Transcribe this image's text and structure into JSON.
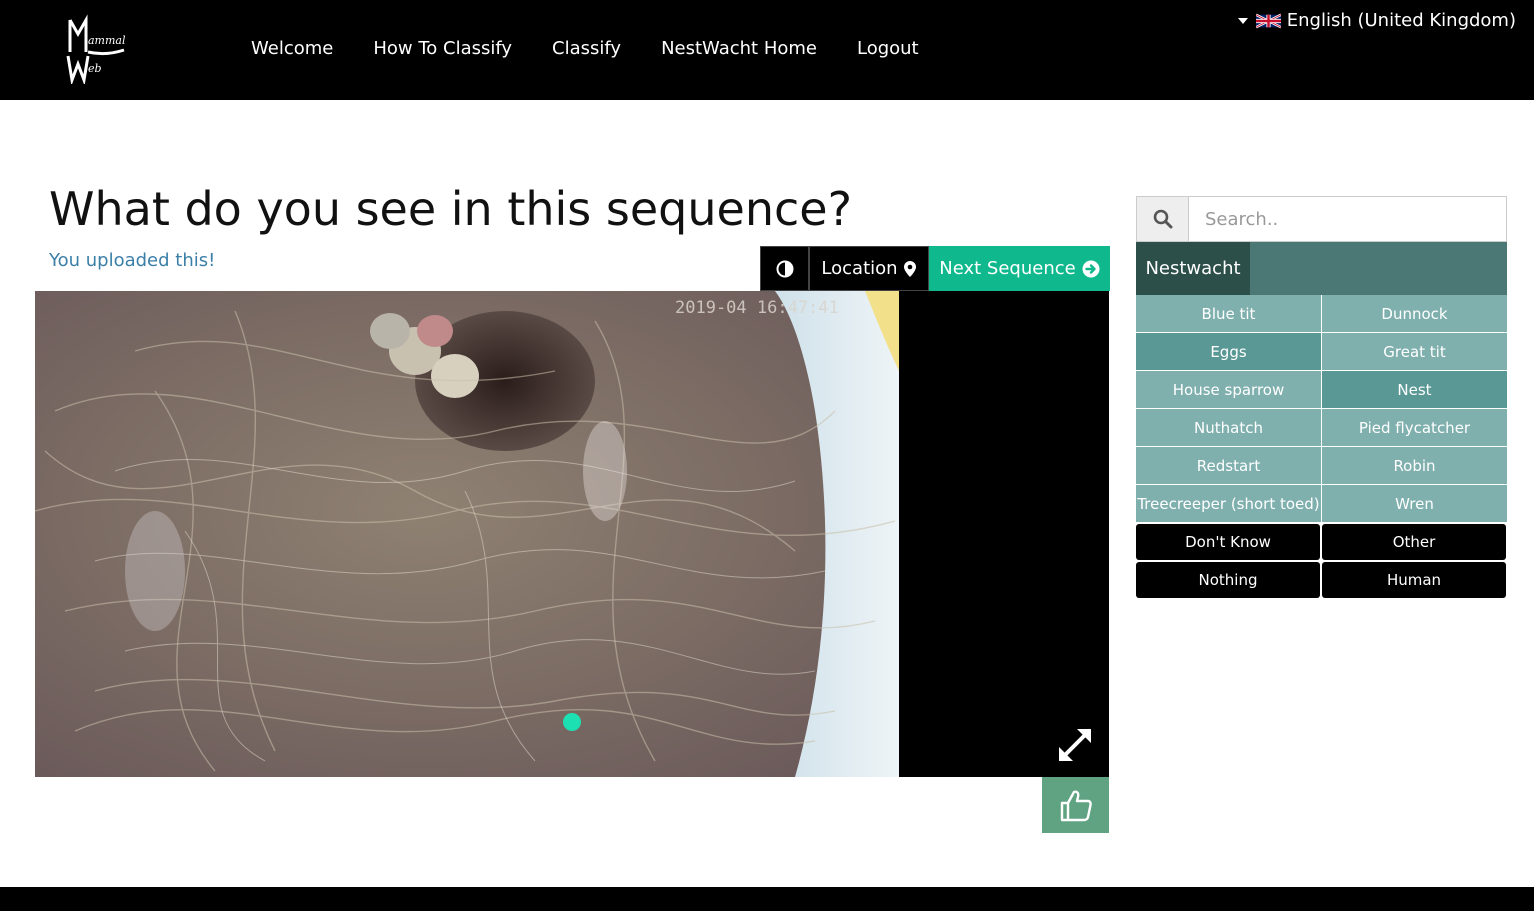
{
  "header": {
    "logo_alt": "Mammal Web",
    "nav": [
      "Welcome",
      "How To Classify",
      "Classify",
      "NestWacht Home",
      "Logout"
    ],
    "language": "English (United Kingdom)"
  },
  "main": {
    "title": "What do you see in this sequence?",
    "uploaded_note": "You uploaded this!",
    "toolbar": {
      "location_label": "Location",
      "next_label": "Next Sequence"
    },
    "timestamp": "2019-04   16:47:41"
  },
  "species_panel": {
    "search_placeholder": "Search..",
    "tab": "Nestwacht",
    "species": [
      "Blue tit",
      "Dunnock",
      "Eggs",
      "Great tit",
      "House sparrow",
      "Nest",
      "Nuthatch",
      "Pied flycatcher",
      "Redstart",
      "Robin",
      "Treecreeper (short toed)",
      "Wren"
    ],
    "special": [
      "Don't Know",
      "Other",
      "Nothing",
      "Human"
    ]
  },
  "colors": {
    "accent_green": "#0fb98d",
    "tab_dark": "#2c4f4a",
    "species_light": "#7fb0ae",
    "species_dark": "#5a9896",
    "like_green": "#5fa383",
    "link_blue": "#3b7fa8"
  }
}
